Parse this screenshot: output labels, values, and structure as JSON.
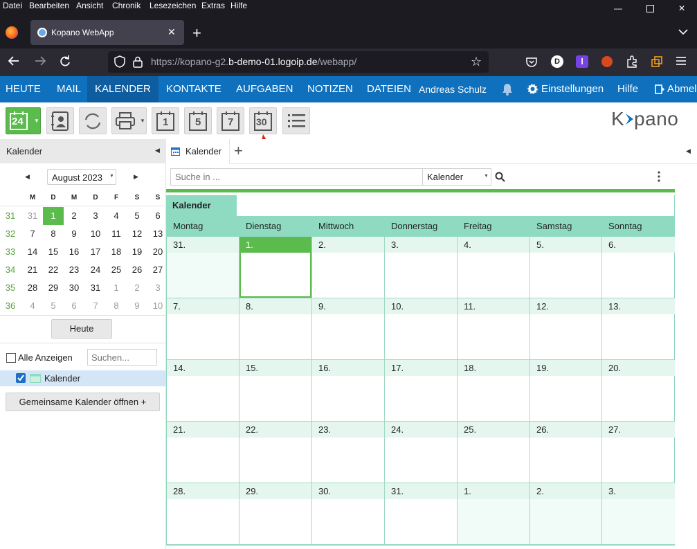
{
  "browser": {
    "menu": [
      "Datei",
      "Bearbeiten",
      "Ansicht",
      "Chronik",
      "Lesezeichen",
      "Extras",
      "Hilfe"
    ],
    "tab_title": "Kopano WebApp",
    "url_prefix": "https://kopano-g2.",
    "url_domain": "b-demo-01.logoip.de",
    "url_suffix": "/webapp/",
    "profile_initial": "D",
    "ext_initial": "l"
  },
  "nav": {
    "items": [
      "HEUTE",
      "MAIL",
      "KALENDER",
      "KONTAKTE",
      "AUFGABEN",
      "NOTIZEN",
      "DATEIEN"
    ],
    "active": "KALENDER",
    "user": "Andreas Schulz",
    "settings": "Einstellungen",
    "help": "Hilfe",
    "logout": "Abmel"
  },
  "toolbar": {
    "new_label": "24",
    "view_day": "1",
    "view_workweek": "5",
    "view_week": "7",
    "view_month": "30",
    "logo_text": "K▸pano"
  },
  "left": {
    "header": "Kalender",
    "month_label": "August 2023",
    "weekday_headers": [
      "M",
      "D",
      "M",
      "D",
      "F",
      "S",
      "S"
    ],
    "weeks": [
      {
        "wk": "31",
        "days": [
          "31",
          "31",
          "1",
          "2",
          "3",
          "4",
          "5",
          "6"
        ]
      },
      {
        "wk": "32",
        "days": [
          "7",
          "8",
          "9",
          "10",
          "11",
          "12",
          "13"
        ]
      },
      {
        "wk": "33",
        "days": [
          "14",
          "15",
          "16",
          "17",
          "18",
          "19",
          "20"
        ]
      },
      {
        "wk": "34",
        "days": [
          "21",
          "22",
          "23",
          "24",
          "25",
          "26",
          "27"
        ]
      },
      {
        "wk": "35",
        "days": [
          "28",
          "29",
          "30",
          "31",
          "1",
          "2",
          "3"
        ]
      },
      {
        "wk": "36",
        "days": [
          "4",
          "5",
          "6",
          "7",
          "8",
          "9",
          "10"
        ]
      }
    ],
    "today_button": "Heute",
    "show_all": "Alle Anzeigen",
    "search_placeholder": "Suchen...",
    "calendar_item": "Kalender",
    "shared_button": "Gemeinsame Kalender öffnen +"
  },
  "main": {
    "tab_label": "Kalender",
    "search_placeholder": "Suche in ...",
    "search_scope": "Kalender",
    "calendar_header": "Kalender",
    "days": [
      "Montag",
      "Dienstag",
      "Mittwoch",
      "Donnerstag",
      "Freitag",
      "Samstag",
      "Sonntag"
    ],
    "grid": [
      [
        "31.",
        "1.",
        "2.",
        "3.",
        "4.",
        "5.",
        "6."
      ],
      [
        "7.",
        "8.",
        "9.",
        "10.",
        "11.",
        "12.",
        "13."
      ],
      [
        "14.",
        "15.",
        "16.",
        "17.",
        "18.",
        "19.",
        "20."
      ],
      [
        "21.",
        "22.",
        "23.",
        "24.",
        "25.",
        "26.",
        "27."
      ],
      [
        "28.",
        "29.",
        "30.",
        "31.",
        "1.",
        "2.",
        "3."
      ]
    ]
  },
  "colors": {
    "brand_blue": "#0f70bd",
    "green": "#5bbb4d",
    "mint": "#8fdbc1",
    "annotation_arrow": "#e02020"
  }
}
